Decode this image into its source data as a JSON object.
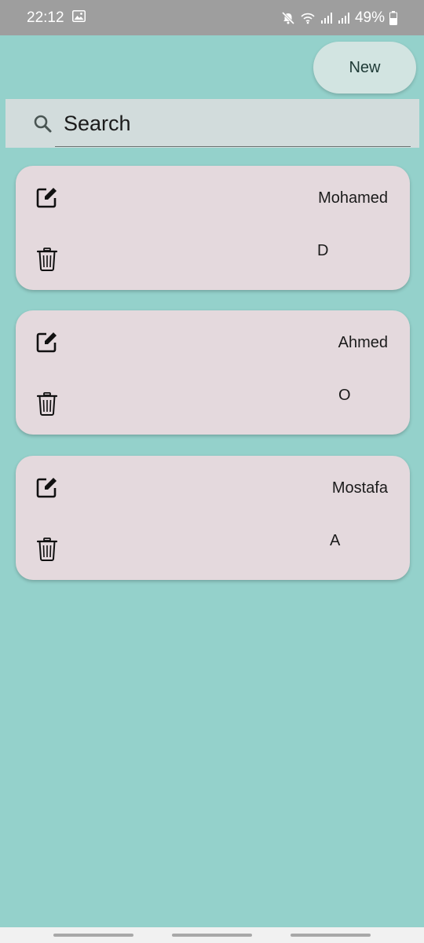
{
  "status_bar": {
    "time": "22:12",
    "battery": "49%"
  },
  "toolbar": {
    "new_label": "New"
  },
  "search": {
    "placeholder": "Search"
  },
  "contacts": [
    {
      "name": "Mohamed",
      "initial": "D"
    },
    {
      "name": "Ahmed",
      "initial": "O"
    },
    {
      "name": "Mostafa",
      "initial": "A"
    }
  ],
  "colors": {
    "background": "#94d1cb",
    "card": "#e4d9dd",
    "status_bar": "#9e9e9e",
    "search_bar": "#d2dcdc",
    "new_button": "#d2e4e1"
  }
}
